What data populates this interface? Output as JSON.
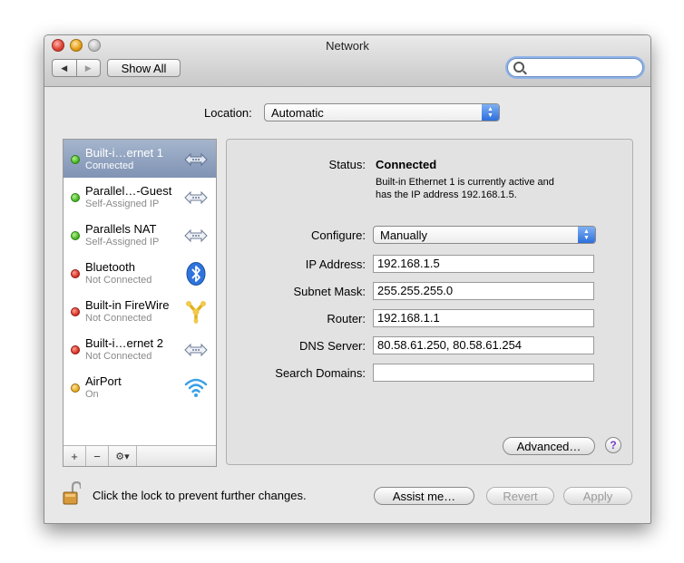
{
  "window": {
    "title": "Network"
  },
  "toolbar": {
    "back": "◀",
    "forward": "▶",
    "show_all": "Show All",
    "search_placeholder": ""
  },
  "location": {
    "label": "Location:",
    "value": "Automatic"
  },
  "services": [
    {
      "name": "Built-i…ernet 1",
      "status": "Connected",
      "dot": "green",
      "icon": "ethernet-icon",
      "selected": true
    },
    {
      "name": "Parallel…-Guest",
      "status": "Self-Assigned IP",
      "dot": "green",
      "icon": "ethernet-icon"
    },
    {
      "name": "Parallels NAT",
      "status": "Self-Assigned IP",
      "dot": "green",
      "icon": "ethernet-icon"
    },
    {
      "name": "Bluetooth",
      "status": "Not Connected",
      "dot": "red",
      "icon": "bluetooth-icon"
    },
    {
      "name": "Built-in FireWire",
      "status": "Not Connected",
      "dot": "red",
      "icon": "firewire-icon"
    },
    {
      "name": "Built-i…ernet 2",
      "status": "Not Connected",
      "dot": "red",
      "icon": "ethernet-icon"
    },
    {
      "name": "AirPort",
      "status": "On",
      "dot": "yellow",
      "icon": "airport-icon"
    }
  ],
  "sidebar_controls": {
    "add": "+",
    "remove": "−",
    "gear": "⚙▾"
  },
  "detail": {
    "status_label": "Status:",
    "status_value": "Connected",
    "status_desc_1": "Built-in Ethernet 1 is currently active and",
    "status_desc_2": "has the IP address 192.168.1.5.",
    "configure_label": "Configure:",
    "configure_value": "Manually",
    "ip_label": "IP Address:",
    "ip_value": "192.168.1.5",
    "subnet_label": "Subnet Mask:",
    "subnet_value": "255.255.255.0",
    "router_label": "Router:",
    "router_value": "192.168.1.1",
    "dns_label": "DNS Server:",
    "dns_value": "80.58.61.250, 80.58.61.254",
    "search_domains_label": "Search Domains:",
    "search_domains_value": "",
    "advanced": "Advanced…",
    "help": "?"
  },
  "footer": {
    "lock_text": "Click the lock to prevent further changes.",
    "assist": "Assist me…",
    "revert": "Revert",
    "apply": "Apply"
  },
  "colors": {
    "selection": "#8fa1bf",
    "accent": "#2d6fdc"
  }
}
